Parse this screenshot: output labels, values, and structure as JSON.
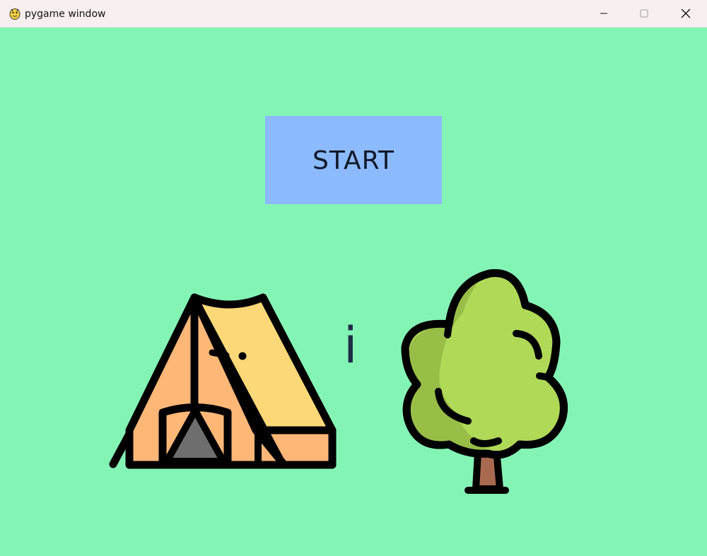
{
  "window": {
    "title": "pygame window",
    "app_icon": "pygame-snake-icon",
    "controls": {
      "minimize_icon": "minimize-icon",
      "maximize_icon": "maximize-icon",
      "close_icon": "close-icon"
    }
  },
  "game": {
    "background_color": "#84f4b5",
    "start_button": {
      "label": "START",
      "color": "#8cbaff"
    },
    "left_image": "tent-icon",
    "conjunction": "i",
    "right_image": "tree-icon"
  }
}
